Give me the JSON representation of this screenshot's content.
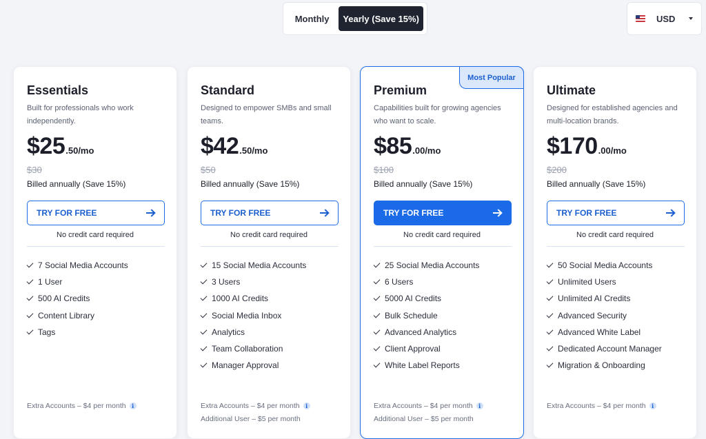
{
  "billing_toggle": {
    "monthly_label": "Monthly",
    "yearly_label": "Yearly (Save 15%)",
    "selected": "yearly"
  },
  "currency": {
    "label": "USD",
    "flag_icon": "us-flag-icon"
  },
  "plans": [
    {
      "name": "Essentials",
      "description": "Built for professionals who work independently.",
      "price_main": "$25",
      "price_cents": ".50",
      "price_period": "/mo",
      "old_price": "$30",
      "billed": "Billed annually (Save 15%)",
      "cta": "TRY FOR FREE",
      "no_cc": "No credit card required",
      "features": [
        "7 Social Media Accounts",
        "1 User",
        "500 AI Credits",
        "Content Library",
        "Tags"
      ],
      "extras": [
        "Extra Accounts – $4 per month"
      ]
    },
    {
      "name": "Standard",
      "description": "Designed to empower SMBs and small teams.",
      "price_main": "$42",
      "price_cents": ".50",
      "price_period": "/mo",
      "old_price": "$50",
      "billed": "Billed annually (Save 15%)",
      "cta": "TRY FOR FREE",
      "no_cc": "No credit card required",
      "features": [
        "15 Social Media Accounts",
        "3 Users",
        "1000 AI Credits",
        "Social Media Inbox",
        "Analytics",
        "Team Collaboration",
        "Manager Approval"
      ],
      "extras": [
        "Extra Accounts – $4 per month",
        "Additional User – $5 per month"
      ]
    },
    {
      "name": "Premium",
      "badge": "Most Popular",
      "description": "Capabilities built for growing agencies who want to scale.",
      "price_main": "$85",
      "price_cents": ".00",
      "price_period": "/mo",
      "old_price": "$100",
      "billed": "Billed annually (Save 15%)",
      "cta": "TRY FOR FREE",
      "no_cc": "No credit card required",
      "features": [
        "25 Social Media Accounts",
        "6 Users",
        "5000 AI Credits",
        "Bulk Schedule",
        "Advanced Analytics",
        "Client Approval",
        "White Label Reports"
      ],
      "extras": [
        "Extra Accounts – $4 per month",
        "Additional User – $5 per month"
      ]
    },
    {
      "name": "Ultimate",
      "description": "Designed for established agencies and multi-location brands.",
      "price_main": "$170",
      "price_cents": ".00",
      "price_period": "/mo",
      "old_price": "$200",
      "billed": "Billed annually (Save 15%)",
      "cta": "TRY FOR FREE",
      "no_cc": "No credit card required",
      "features": [
        "50 Social Media Accounts",
        "Unlimited Users",
        "Unlimited AI Credits",
        "Advanced Security",
        "Advanced White Label",
        "Dedicated Account Manager",
        "Migration & Onboarding"
      ],
      "extras": [
        "Extra Accounts – $4 per month"
      ]
    }
  ],
  "colors": {
    "accent": "#1b6ae8",
    "dark_toggle": "#1f2430",
    "badge_bg": "#dbe8fb"
  },
  "icons": {
    "check": "check-icon",
    "arrow": "arrow-right-icon",
    "info": "info-icon",
    "caret": "caret-down-icon"
  }
}
